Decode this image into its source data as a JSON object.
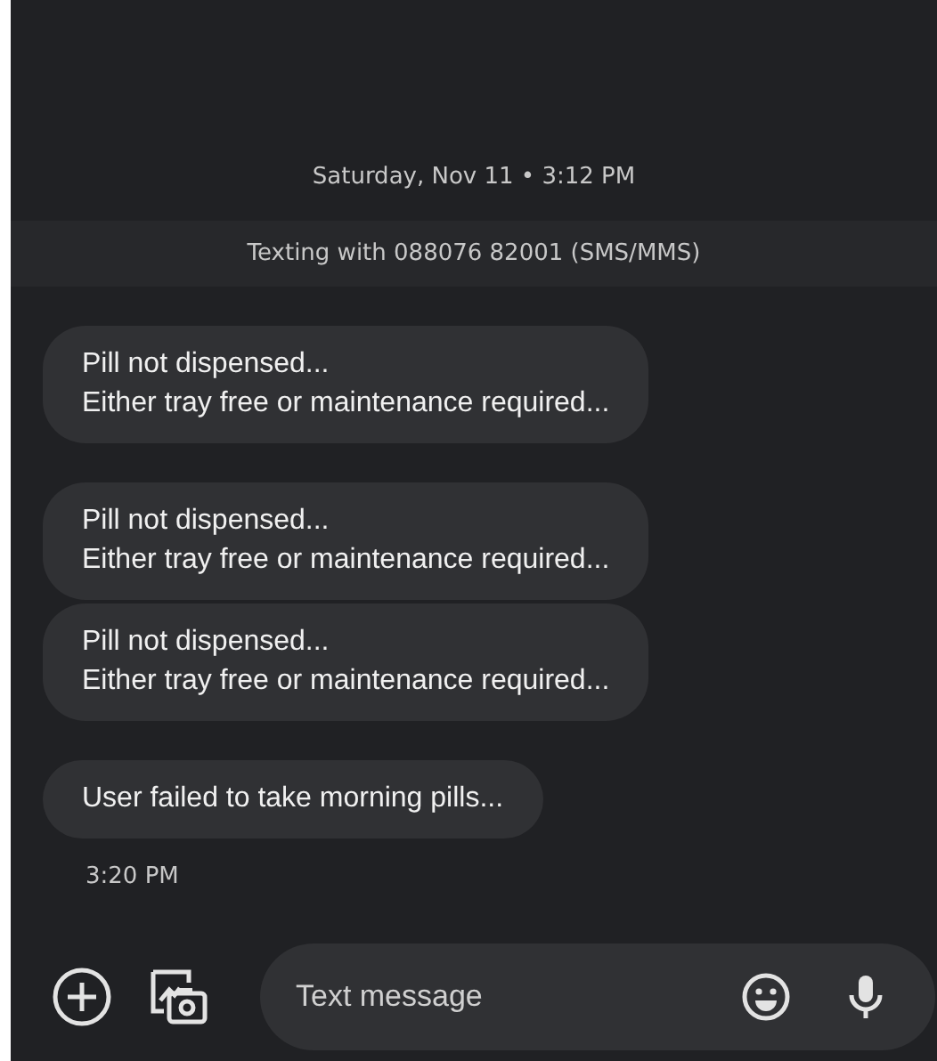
{
  "date_header": "Saturday, Nov 11 • 3:12 PM",
  "banner": "Texting with 088076 82001 (SMS/MMS)",
  "message_groups": [
    {
      "messages": [
        {
          "text": "Pill not dispensed...\nEither tray free or maintenance required..."
        }
      ]
    },
    {
      "messages": [
        {
          "text": "Pill not dispensed...\nEither tray free or maintenance required..."
        },
        {
          "text": "Pill not dispensed...\nEither tray free or maintenance required..."
        }
      ]
    },
    {
      "messages": [
        {
          "text": "User failed to take morning pills..."
        }
      ],
      "time": "3:20 PM"
    }
  ],
  "composer": {
    "placeholder": "Text message"
  }
}
